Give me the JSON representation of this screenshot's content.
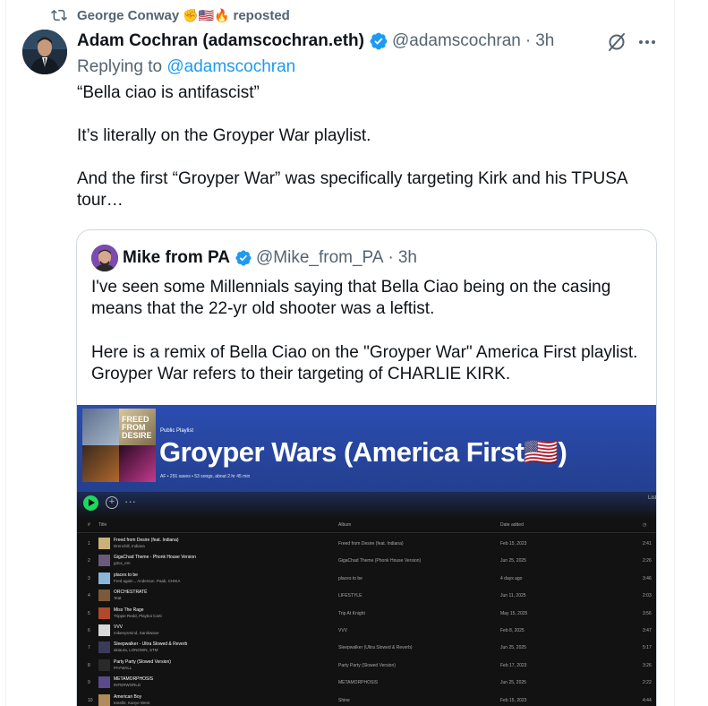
{
  "repost": {
    "name": "George Conway",
    "emoji": "✊🇺🇸🔥",
    "label": "reposted"
  },
  "tweet": {
    "name": "Adam Cochran (adamscochran.eth)",
    "handle": "@adamscochran",
    "dot": "·",
    "time": "3h",
    "reply_prefix": "Replying to",
    "reply_mention": "@adamscochran",
    "paragraphs": [
      "“Bella ciao is antifascist”",
      "It’s literally on the Groyper War playlist.",
      "And the first “Groyper War” was specifically targeting Kirk and his TPUSA tour…"
    ]
  },
  "quote": {
    "name": "Mike from PA",
    "handle": "@Mike_from_PA",
    "dot": "·",
    "time": "3h",
    "paragraphs": [
      "I've seen some Millennials saying that Bella Ciao being on the casing means that the 22-yr old shooter was a leftist.",
      "Here is a remix of Bella Ciao on the \"Groyper War\" America First playlist. Groyper War refers to their targeting of CHARLIE KIRK."
    ]
  },
  "playlist": {
    "cover_text": "FREED FROM DESIRE",
    "kind": "Public Playlist",
    "title": "Groyper Wars (America First🇺🇸)",
    "meta": "AF • 291 saves • 53 songs, about 2 hr 45 min",
    "list_label": "List",
    "columns": {
      "num": "#",
      "title": "Title",
      "album": "Album",
      "date": "Date added",
      "dur": "◷"
    },
    "tracks": [
      {
        "n": "1",
        "title": "Freed from Desire (feat. Indiana)",
        "artist": "Drenchill, Indiana",
        "album": "Freed from Desire (feat. Indiana)",
        "date": "Feb 15, 2023",
        "dur": "2:41",
        "color": "#c9b27a"
      },
      {
        "n": "2",
        "title": "GigaChad Theme - Phonk House Version",
        "artist": "g3ox_em",
        "album": "GigaChad Theme (Phonk House Version)",
        "date": "Jun 25, 2025",
        "dur": "2:26",
        "color": "#6a5a7c"
      },
      {
        "n": "3",
        "title": "places to be",
        "artist": "Fred again.., Anderson .Paak, CHIKA",
        "album": "places to be",
        "date": "4 days ago",
        "dur": "3:46",
        "color": "#8bb7d8"
      },
      {
        "n": "4",
        "title": "ORCHESTRATÉ",
        "artist": "Teat",
        "album": "LIFESTYLE",
        "date": "Jun 11, 2025",
        "dur": "2:03",
        "color": "#7a5a3a"
      },
      {
        "n": "5",
        "title": "Miss The Rage",
        "artist": "Trippie Redd, Playboi Carti",
        "album": "Trip At Knight",
        "date": "May 15, 2025",
        "dur": "3:56",
        "color": "#b04a2a"
      },
      {
        "n": "6",
        "title": "VVV",
        "artist": "mikeeysmind, Sanikwave",
        "album": "VVV",
        "date": "Feb 8, 2025",
        "dur": "3:47",
        "color": "#d8d8d8"
      },
      {
        "n": "7",
        "title": "Sleepwalker - Ultra Slowed & Reverb",
        "artist": "akiaura, LONOWN, STM",
        "album": "Sleepwalker (Ultra Slowed & Reverb)",
        "date": "Jun 25, 2025",
        "dur": "5:17",
        "color": "#3a3a5a"
      },
      {
        "n": "8",
        "title": "Party Party (Slowed Version)",
        "artist": "PAYWALL",
        "album": "Party Party (Slowed Version)",
        "date": "Feb 17, 2023",
        "dur": "3:26",
        "color": "#2a2a2a"
      },
      {
        "n": "9",
        "title": "METAMORPHOSIS",
        "artist": "INTERWORLD",
        "album": "METAMORPHOSIS",
        "date": "Jun 25, 2025",
        "dur": "2:22",
        "color": "#5a4a8a"
      },
      {
        "n": "10",
        "title": "American Boy",
        "artist": "Estelle, Kanye West",
        "album": "Shine",
        "date": "Feb 15, 2023",
        "dur": "4:44",
        "color": "#b08a5a"
      }
    ]
  }
}
